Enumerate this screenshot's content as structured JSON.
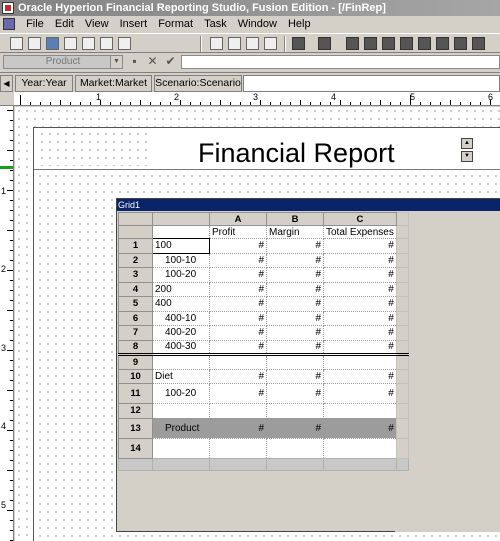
{
  "window": {
    "title": "Oracle Hyperion Financial Reporting Studio, Fusion Edition - [/FinRep]"
  },
  "menu": [
    "File",
    "Edit",
    "View",
    "Insert",
    "Format",
    "Task",
    "Window",
    "Help"
  ],
  "member_selector": {
    "value": "Product"
  },
  "pov": {
    "items": [
      "Year:Year",
      "Market:Market",
      "Scenario:Scenario"
    ]
  },
  "ruler": {
    "top": [
      "1",
      "2",
      "3",
      "4",
      "5",
      "6"
    ],
    "left": [
      "1",
      "2",
      "3",
      "4",
      "5"
    ]
  },
  "report": {
    "title": "Financial Report"
  },
  "grid": {
    "name": "Grid1",
    "columns": [
      {
        "letter": "A",
        "header": "Profit"
      },
      {
        "letter": "B",
        "header": "Margin"
      },
      {
        "letter": "C",
        "header": "Total Expenses"
      }
    ],
    "rows": [
      {
        "num": "1",
        "label": "100",
        "indent": false,
        "values": [
          "#",
          "#",
          "#"
        ]
      },
      {
        "num": "2",
        "label": "100-10",
        "indent": true,
        "values": [
          "#",
          "#",
          "#"
        ]
      },
      {
        "num": "3",
        "label": "100-20",
        "indent": true,
        "values": [
          "#",
          "#",
          "#"
        ]
      },
      {
        "num": "4",
        "label": "200",
        "indent": false,
        "values": [
          "#",
          "#",
          "#"
        ]
      },
      {
        "num": "5",
        "label": "400",
        "indent": false,
        "values": [
          "#",
          "#",
          "#"
        ]
      },
      {
        "num": "6",
        "label": "400-10",
        "indent": true,
        "values": [
          "#",
          "#",
          "#"
        ]
      },
      {
        "num": "7",
        "label": "400-20",
        "indent": true,
        "values": [
          "#",
          "#",
          "#"
        ]
      },
      {
        "num": "8",
        "label": "400-30",
        "indent": true,
        "values": [
          "#",
          "#",
          "#"
        ]
      },
      {
        "num": "9",
        "label": "",
        "indent": false,
        "values": [
          "",
          "",
          ""
        ]
      },
      {
        "num": "10",
        "label": "Diet",
        "indent": false,
        "values": [
          "#",
          "#",
          "#"
        ]
      },
      {
        "num": "11",
        "label": "100-20",
        "indent": true,
        "values": [
          "#",
          "#",
          "#"
        ]
      },
      {
        "num": "12",
        "label": "",
        "indent": false,
        "values": [
          "",
          "",
          ""
        ]
      },
      {
        "num": "13",
        "label": "Product",
        "indent": true,
        "values": [
          "#",
          "#",
          "#"
        ]
      },
      {
        "num": "14",
        "label": "",
        "indent": false,
        "values": [
          "",
          "",
          ""
        ]
      }
    ]
  }
}
